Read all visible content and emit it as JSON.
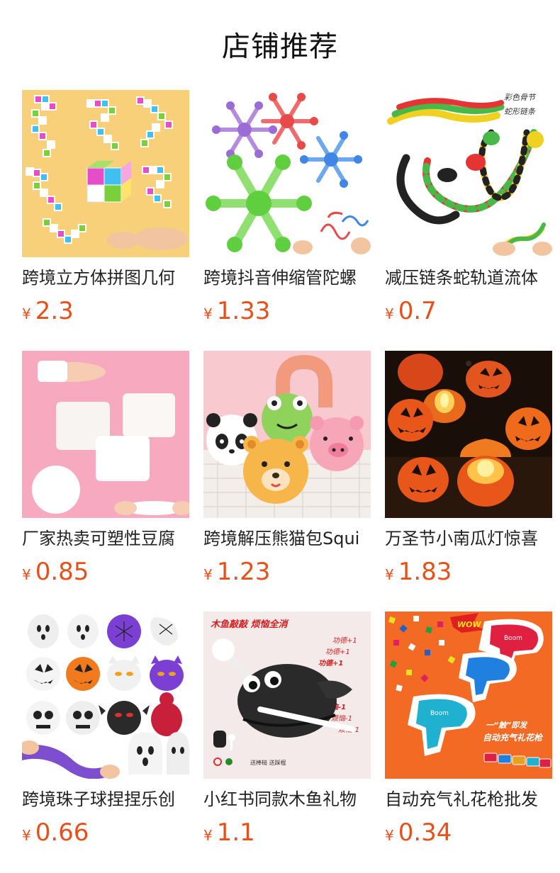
{
  "section": {
    "title": "店铺推荐"
  },
  "products": [
    {
      "name": "跨境立方体拼图几何",
      "currency": "¥",
      "price": "2.3",
      "image_icon": "cube-puzzle-toy-image"
    },
    {
      "name": "跨境抖音伸缩管陀螺",
      "currency": "¥",
      "price": "1.33",
      "image_icon": "spinner-tube-toy-image"
    },
    {
      "name": "减压链条蛇轨道流体",
      "currency": "¥",
      "price": "0.7",
      "image_icon": "chain-snake-toy-image",
      "image_caption_1": "彩色骨节",
      "image_caption_2": "蛇形链条"
    },
    {
      "name": "厂家热卖可塑性豆腐",
      "currency": "¥",
      "price": "0.85",
      "image_icon": "tofu-squishy-toy-image"
    },
    {
      "name": "跨境解压熊猫包Squi",
      "currency": "¥",
      "price": "1.23",
      "image_icon": "panda-squishy-toy-image"
    },
    {
      "name": "万圣节小南瓜灯惊喜",
      "currency": "¥",
      "price": "1.83",
      "image_icon": "pumpkin-lantern-image"
    },
    {
      "name": "跨境珠子球捏捏乐创",
      "currency": "¥",
      "price": "0.66",
      "image_icon": "bead-ball-squeeze-image"
    },
    {
      "name": "小红书同款木鱼礼物",
      "currency": "¥",
      "price": "1.1",
      "image_icon": "wooden-fish-gift-image",
      "image_caption_1": "木鱼敲敲 烦恼全消",
      "merit_1": "功德+1",
      "merit_2": "功德+1",
      "merit_3": "功德+1",
      "worry_1": "烦恼-1",
      "worry_2": "烦恼-1",
      "worry_3": "烦恼-1",
      "image_caption_2": "送棒槌 送踩棍"
    },
    {
      "name": "自动充气礼花枪批发",
      "currency": "¥",
      "price": "0.34",
      "image_icon": "confetti-gun-image",
      "image_caption_1": "WOW",
      "image_caption_2": "一“触”即发",
      "image_caption_3": "自动充气礼花枪",
      "image_caption_4": "Boom"
    }
  ],
  "colors": {
    "price": "#e8501a",
    "name": "#222222",
    "title": "#111111"
  }
}
